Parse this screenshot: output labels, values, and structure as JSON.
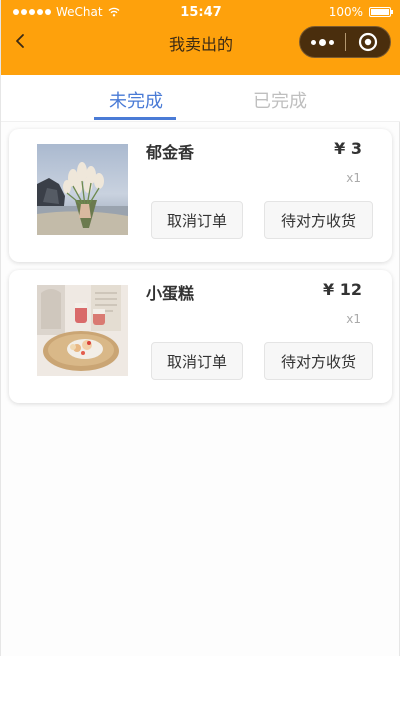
{
  "status_bar": {
    "carrier": "WeChat",
    "time": "15:47",
    "battery": "100%"
  },
  "navbar": {
    "title": "我卖出的",
    "back_icon": "chevron-left-icon",
    "menu_icon": "more-dots-icon",
    "close_icon": "target-circle-icon"
  },
  "colors": {
    "header_bg": "#fea10c",
    "tab_active": "#4a7bd6",
    "tab_inactive": "#bfbfbf"
  },
  "tabs": [
    {
      "label": "未完成",
      "active": true
    },
    {
      "label": "已完成",
      "active": false
    }
  ],
  "orders": [
    {
      "name": "郁金香",
      "price": "¥ 3",
      "quantity": "x1",
      "image": "tulip-bouquet-photo",
      "cancel_label": "取消订单",
      "status_label": "待对方收货"
    },
    {
      "name": "小蛋糕",
      "price": "¥ 12",
      "quantity": "x1",
      "image": "cake-plate-photo",
      "cancel_label": "取消订单",
      "status_label": "待对方收货"
    }
  ]
}
